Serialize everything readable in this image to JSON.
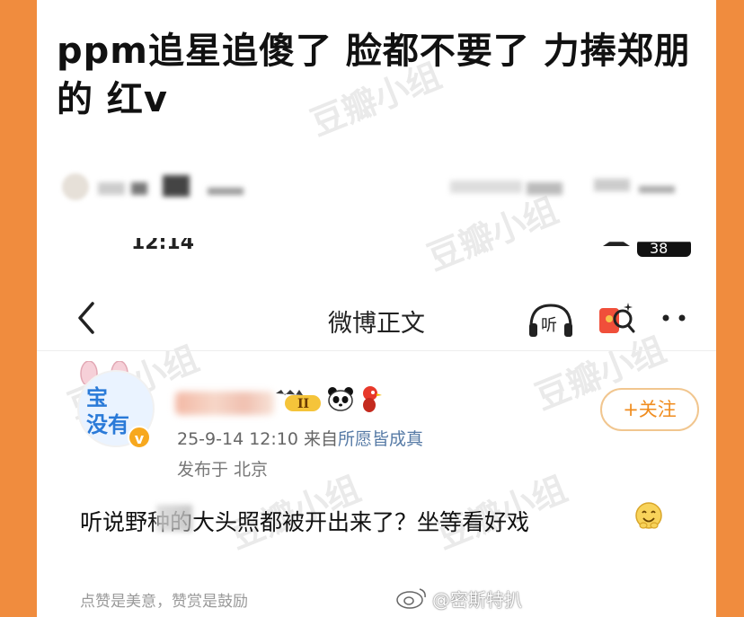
{
  "post": {
    "headline": "ppm追星追傻了 脸都不要了 力捧郑朋的 红v"
  },
  "phone": {
    "time": "12:14",
    "battery": "38"
  },
  "nav": {
    "title": "微博正文",
    "listen_label": "听"
  },
  "weibo": {
    "level": "II",
    "verified_mark": "v",
    "timestamp": "25-9-14 12:10",
    "source_prefix": "来自",
    "source": "所愿皆成真",
    "location": "发布于 北京",
    "follow_label": "+关注",
    "avatar_text": "宝\n没有",
    "body": "听说野种的大头照都被开出来了？坐等看好戏",
    "footer": "点赞是美意，赞赏是鼓励"
  },
  "watermark": {
    "text": "豆瓣小组",
    "credit": "@密斯特扒"
  },
  "colors": {
    "border": "#f08c3e",
    "follow": "#f08c1e",
    "source_link": "#577ba6",
    "verified": "#f7a81e"
  },
  "icons": [
    "back-chevron",
    "headphones",
    "red-envelope",
    "more-dots",
    "panda",
    "bird",
    "level-badge",
    "smiling-emoji",
    "weibo-logo"
  ]
}
